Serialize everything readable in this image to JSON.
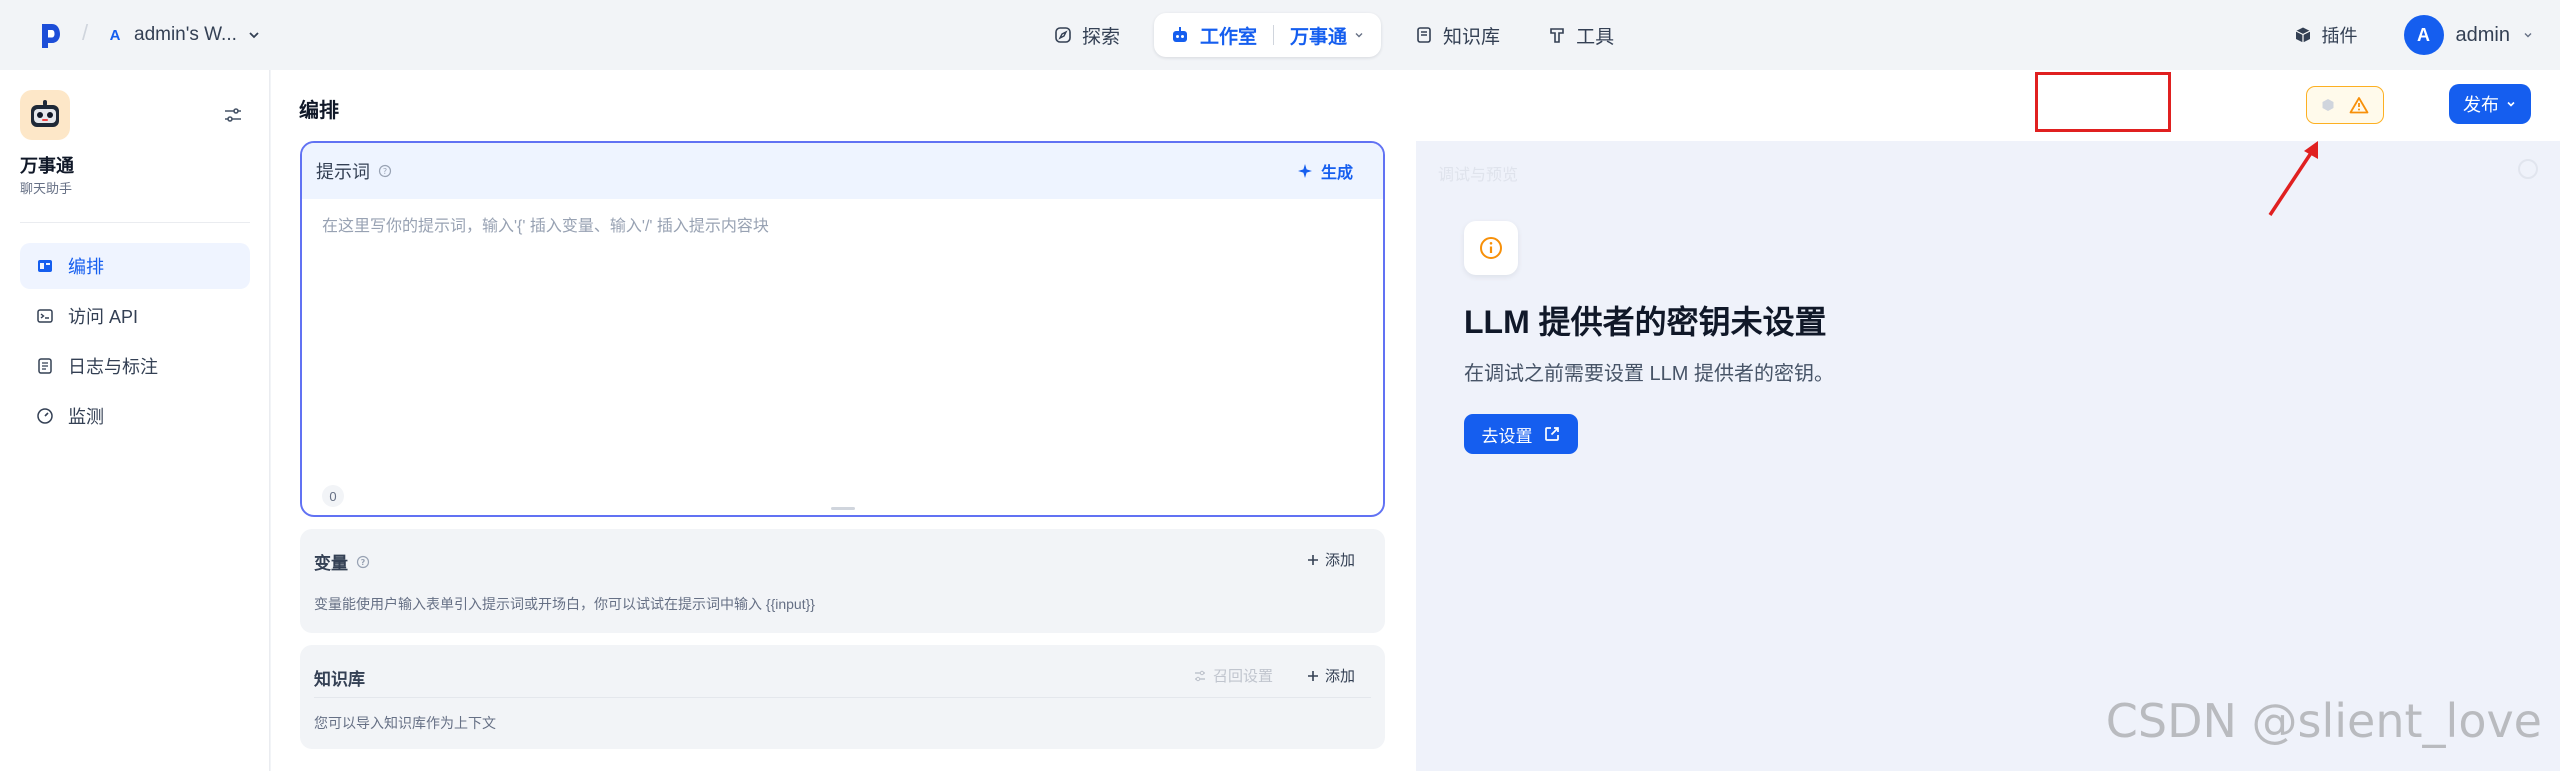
{
  "header": {
    "workspace_badge": "A",
    "workspace_name": "admin's W...",
    "nav": {
      "explore": "探索",
      "studio": "工作室",
      "studio_app": "万事通",
      "knowledge": "知识库",
      "tools": "工具"
    },
    "plugins": "插件",
    "user_initial": "A",
    "user_name": "admin"
  },
  "sidebar": {
    "app_name": "万事通",
    "app_mode": "聊天助手",
    "items": [
      {
        "label": "编排",
        "icon": "layout-icon",
        "active": true
      },
      {
        "label": "访问 API",
        "icon": "terminal-icon",
        "active": false
      },
      {
        "label": "日志与标注",
        "icon": "log-icon",
        "active": false
      },
      {
        "label": "监测",
        "icon": "gauge-icon",
        "active": false
      }
    ]
  },
  "main": {
    "title": "编排",
    "publish_label": "发布"
  },
  "prompt": {
    "title": "提示词",
    "generate_label": "生成",
    "placeholder": "在这里写你的提示词，输入'{' 插入变量、输入'/' 插入提示内容块",
    "char_count": "0"
  },
  "variables": {
    "title": "变量",
    "add_label": "添加",
    "description": "变量能使用户输入表单引入提示词或开场白，你可以试试在提示词中输入 {{input}}"
  },
  "knowledge": {
    "title": "知识库",
    "recall_label": "召回设置",
    "add_label": "添加",
    "description": "您可以导入知识库作为上下文"
  },
  "debug": {
    "heading": "调试与预览",
    "llm_title": "LLM 提供者的密钥未设置",
    "llm_desc": "在调试之前需要设置 LLM 提供者的密钥。",
    "goto_label": "去设置"
  },
  "watermark": "CSDN @slient_love",
  "colors": {
    "primary": "#155eef",
    "warning": "#f79009",
    "annotation_red": "#e02020"
  }
}
